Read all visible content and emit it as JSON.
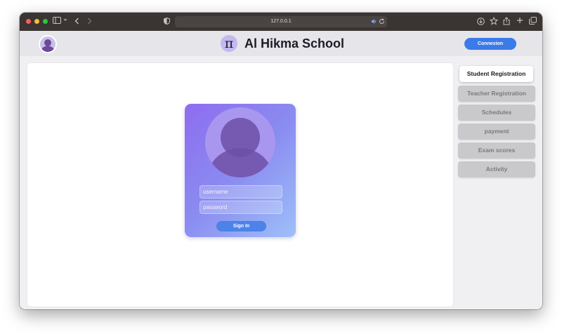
{
  "browser": {
    "url": "127.0.0.1"
  },
  "header": {
    "logo_symbol": "π",
    "title": "Al Hikma School",
    "connexion_label": "Connexion"
  },
  "login": {
    "username_placeholder": "username",
    "password_placeholder": "password",
    "signin_label": "Sign In"
  },
  "nav": {
    "items": [
      {
        "label": "Student Registration",
        "active": true
      },
      {
        "label": "Teacher Registration",
        "active": false
      },
      {
        "label": "Schedules",
        "active": false
      },
      {
        "label": "payment",
        "active": false
      },
      {
        "label": "Exam scores",
        "active": false
      },
      {
        "label": "Activity",
        "active": false
      }
    ]
  },
  "colors": {
    "accent": "#3b7be9",
    "card_gradient_start": "#8e6cf0",
    "card_gradient_end": "#9ec0f8"
  }
}
